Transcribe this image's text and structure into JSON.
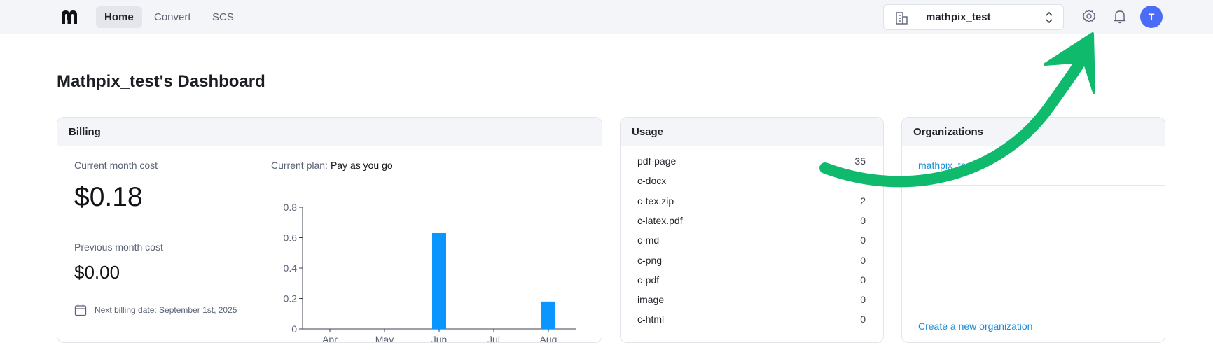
{
  "nav": {
    "tabs": [
      {
        "label": "Home",
        "active": true
      },
      {
        "label": "Convert",
        "active": false
      },
      {
        "label": "SCS",
        "active": false
      }
    ],
    "org_selector": {
      "value": "mathpix_test",
      "icon": "building-icon"
    },
    "icons": [
      "gear-icon",
      "bell-icon"
    ],
    "avatar_initial": "T",
    "avatar_color": "#4a6cf7"
  },
  "page_title": "Mathpix_test's Dashboard",
  "billing": {
    "header": "Billing",
    "current_month_label": "Current month cost",
    "current_month_value": "$0.18",
    "previous_month_label": "Previous month cost",
    "previous_month_value": "$0.00",
    "next_billing_text": "Next billing date: September 1st, 2025",
    "plan_label": "Current plan:",
    "plan_value": "Pay as you go"
  },
  "chart_data": {
    "type": "bar",
    "categories": [
      "Apr",
      "May",
      "Jun",
      "Jul",
      "Aug"
    ],
    "values": [
      0,
      0,
      0.63,
      0,
      0.18
    ],
    "ylim": [
      0,
      0.8
    ],
    "yticks": [
      "0",
      "0.2",
      "0.4",
      "0.6",
      "0.8"
    ],
    "bar_color": "#0a95ff",
    "grid": false
  },
  "usage": {
    "header": "Usage",
    "rows": [
      {
        "name": "pdf-page",
        "count": "35"
      },
      {
        "name": "c-docx",
        "count": ""
      },
      {
        "name": "c-tex.zip",
        "count": "2"
      },
      {
        "name": "c-latex.pdf",
        "count": "0"
      },
      {
        "name": "c-md",
        "count": "0"
      },
      {
        "name": "c-png",
        "count": "0"
      },
      {
        "name": "c-pdf",
        "count": "0"
      },
      {
        "name": "image",
        "count": "0"
      },
      {
        "name": "c-html",
        "count": "0"
      }
    ]
  },
  "organizations": {
    "header": "Organizations",
    "items": [
      "mathpix_te"
    ],
    "create_label": "Create a new organization"
  },
  "colors": {
    "accent_link": "#1a8fd6",
    "annotation_arrow": "#0fba6d"
  }
}
